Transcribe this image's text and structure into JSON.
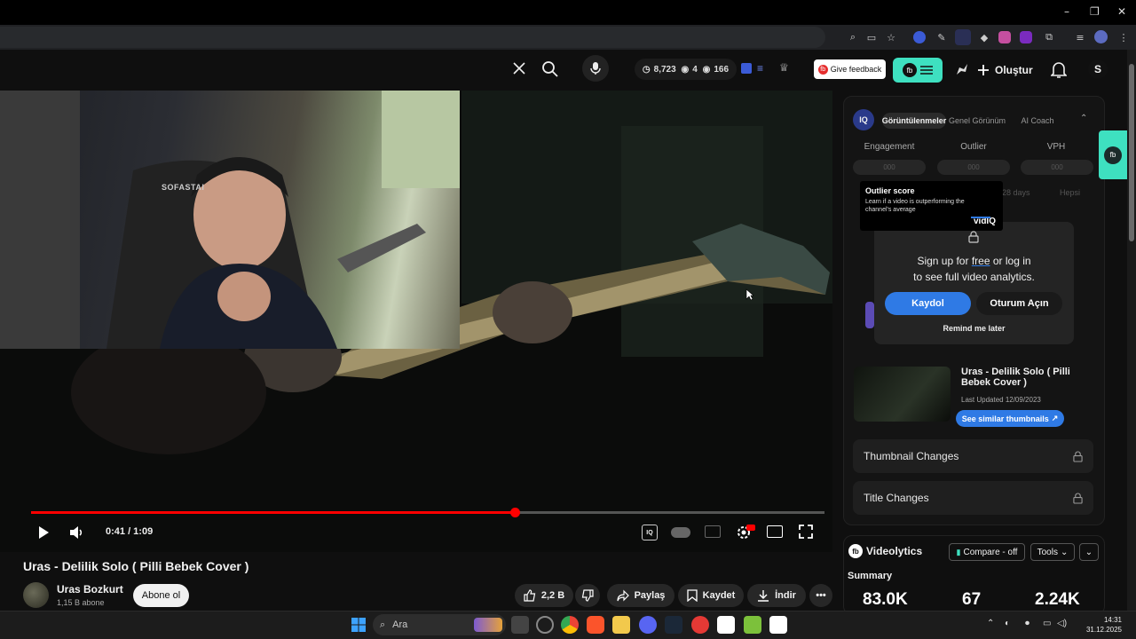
{
  "window": {
    "controls": [
      "–",
      "❐",
      "✕"
    ]
  },
  "yt_header": {
    "stats": {
      "score": "8,723",
      "eyes": "4",
      "views": "166"
    },
    "feedback_label": "Give feedback",
    "create_label": "Oluştur",
    "avatar_letter": "S"
  },
  "player": {
    "time": "0:41 / 1:09",
    "progress_fraction": 0.61,
    "cam_text": "SOFASTAI"
  },
  "video": {
    "title": "Uras - Delilik Solo ( Pilli Bebek Cover )",
    "channel": "Uras Bozkurt",
    "subscribers": "1,15 B abone",
    "subscribe_label": "Abone ol",
    "likes": "2,2 B",
    "share_label": "Paylaş",
    "save_label": "Kaydet",
    "download_label": "İndir"
  },
  "vidiq": {
    "tabs": [
      "Görüntülenmeler",
      "Genel Görünüm",
      "AI Coach"
    ],
    "columns": [
      "Engagement",
      "Outlier",
      "VPH"
    ],
    "blurred": "000",
    "ranges": [
      "28 days",
      "Hepsi"
    ],
    "tooltip_title": "Outlier score",
    "tooltip_body": "Learn if a video is outperforming the channel's average",
    "tooltip_brand": "vidIQ",
    "signup_text_1": "Sign up for",
    "signup_free": "free",
    "signup_text_2": "or log in",
    "signup_text_3": "to see full video analytics.",
    "kaydol": "Kaydol",
    "oturum": "Oturum Açın",
    "remind": "Remind me later",
    "video_title": "Uras - Delilik Solo ( Pilli Bebek Cover )",
    "last_updated": "Last Updated 12/09/2023",
    "similar_label": "See similar thumbnails",
    "thumbnail_changes": "Thumbnail Changes",
    "title_changes": "Title Changes"
  },
  "videolytics": {
    "brand": "Videolytics",
    "compare": "Compare - off",
    "tools": "Tools",
    "summary": "Summary",
    "values": [
      "83.0K",
      "67",
      "2.24K"
    ]
  },
  "taskbar": {
    "search": "Ara",
    "time": "14:31",
    "date": "31.12.2025"
  },
  "colors": {
    "accent_red": "#ff0000",
    "vidiq_blue": "#2f7ae5",
    "teal": "#3ee0c0"
  }
}
